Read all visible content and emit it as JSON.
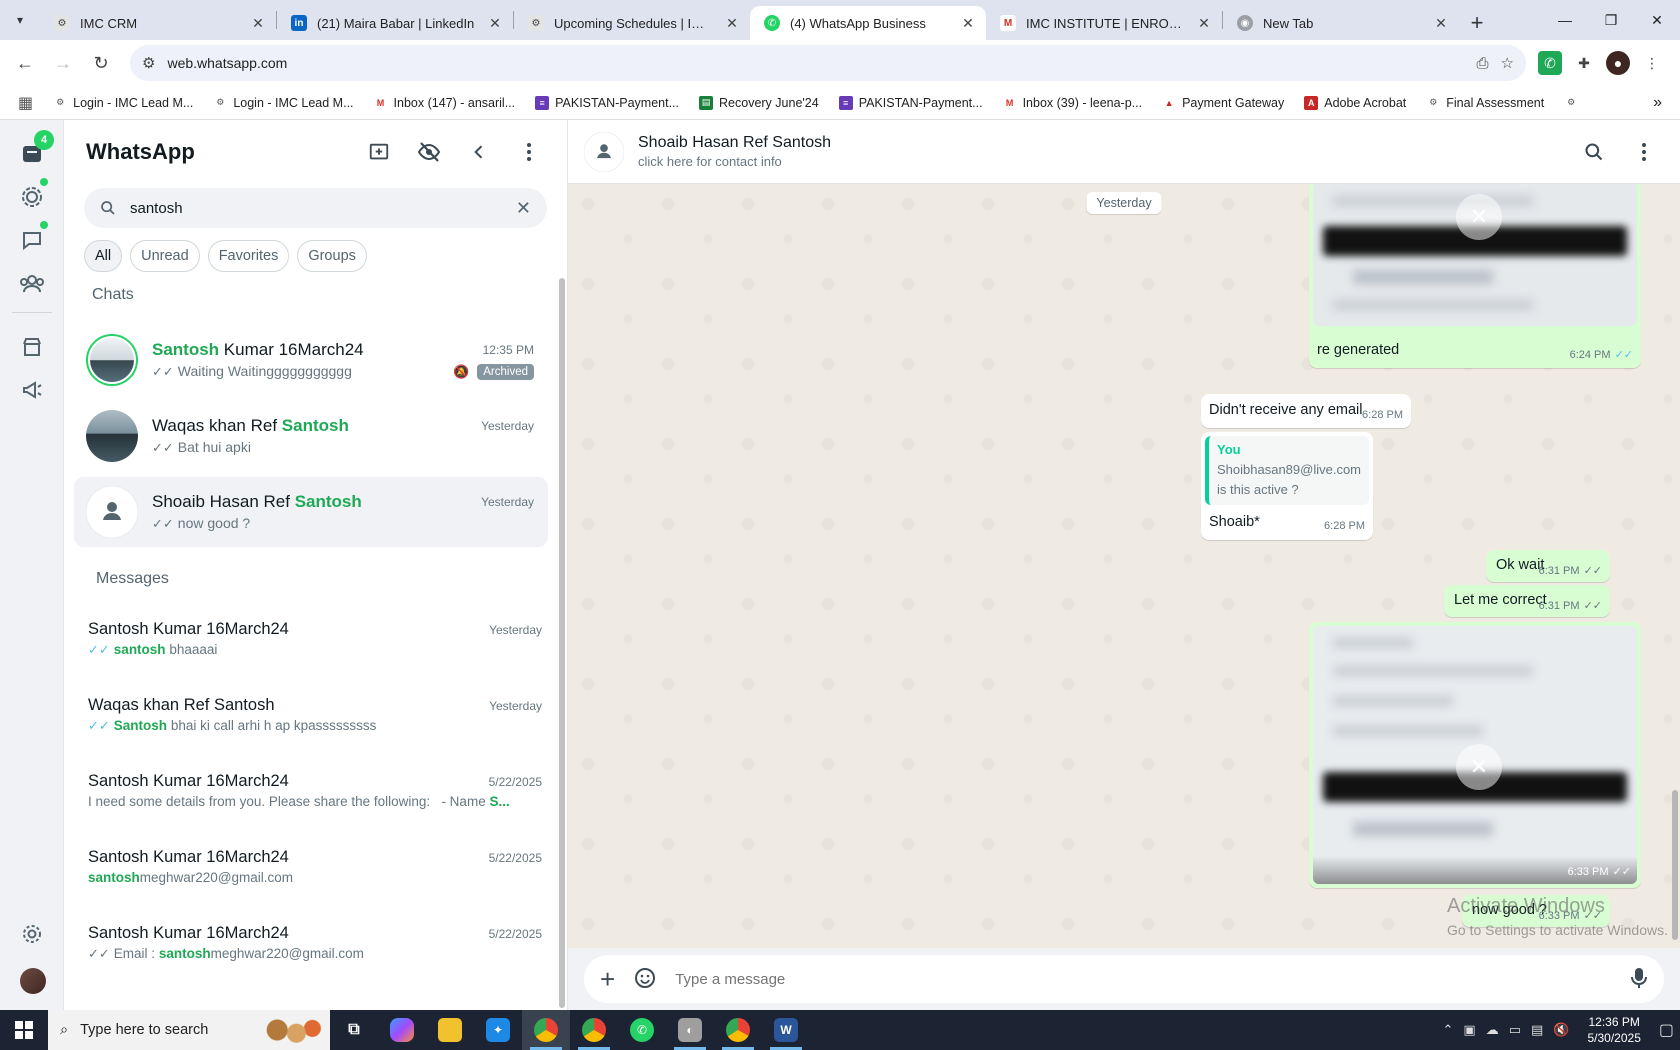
{
  "browser": {
    "tabs": [
      {
        "title": "IMC CRM",
        "active": false
      },
      {
        "title": "(21) Maira Babar | LinkedIn",
        "active": false
      },
      {
        "title": "Upcoming Schedules | IMC Cer",
        "active": false
      },
      {
        "title": "(4) WhatsApp Business",
        "active": true
      },
      {
        "title": "IMC INSTITUTE | ENROLLMENT",
        "active": false
      },
      {
        "title": "New Tab",
        "active": false
      }
    ],
    "url": "web.whatsapp.com",
    "bookmarks": [
      "Login - IMC Lead M...",
      "Login - IMC Lead M...",
      "Inbox (147) - ansaril...",
      "PAKISTAN-Payment...",
      "Recovery June'24",
      "PAKISTAN-Payment...",
      "Inbox (39) - leena-p...",
      "Payment Gateway",
      "Adobe Acrobat",
      "Final Assessment"
    ]
  },
  "rail": {
    "chats_badge": "4"
  },
  "sidebar": {
    "title": "WhatsApp",
    "search_value": "santosh",
    "filters": [
      "All",
      "Unread",
      "Favorites",
      "Groups"
    ],
    "chats_heading": "Chats",
    "messages_heading": "Messages",
    "chats": [
      {
        "name_hl": "Santosh",
        "name_rest": " Kumar 16March24",
        "time": "12:35 PM",
        "preview": "Waiting Waitinggggggggggg",
        "archived": "Archived"
      },
      {
        "name_pre": "Waqas khan Ref ",
        "name_hl": "Santosh",
        "time": "Yesterday",
        "preview": "Bat hui apki"
      },
      {
        "name_pre": "Shoaib Hasan Ref ",
        "name_hl": "Santosh",
        "time": "Yesterday",
        "preview": "now good ?"
      }
    ],
    "messages": [
      {
        "name": "Santosh Kumar 16March24",
        "time": "Yesterday",
        "hl": "santosh",
        "rest": " bhaaaai"
      },
      {
        "name": "Waqas khan Ref Santosh",
        "time": "Yesterday",
        "hl": "Santosh",
        "rest": " bhai ki call arhi h ap kpasssssssss"
      },
      {
        "name": "Santosh Kumar 16March24",
        "time": "5/22/2025",
        "pre": "I need some details from you. Please share the following:   - Name ",
        "hl": "S..."
      },
      {
        "name": "Santosh Kumar 16March24",
        "time": "5/22/2025",
        "hl": "santosh",
        "rest": "meghwar220@gmail.com"
      },
      {
        "name": "Santosh Kumar 16March24",
        "time": "5/22/2025",
        "pre": "Email : ",
        "hl": "santosh",
        "rest": "meghwar220@gmail.com"
      }
    ]
  },
  "conversation": {
    "contact_name": "Shoaib Hasan Ref Santosh",
    "contact_sub": "click here for contact info",
    "date_chip": "Yesterday",
    "messages": {
      "m1_text": "re generated",
      "m1_time": "6:24 PM",
      "m2_text": "Didn't receive any email",
      "m2_time": "6:28 PM",
      "m3_quote_author": "You",
      "m3_quote_line1": "Shoibhasan89@live.com",
      "m3_quote_line2": "is this active ?",
      "m3_text": "Shoaib*",
      "m3_time": "6:28 PM",
      "m4_text": "Ok wait",
      "m4_time": "6:31 PM",
      "m5_text": "Let me correct",
      "m5_time": "6:31 PM",
      "m6_time": "6:33 PM",
      "m7_text": "now good ?",
      "m7_time": "6:33 PM"
    },
    "composer_placeholder": "Type a message",
    "watermark_title": "Activate Windows",
    "watermark_sub": "Go to Settings to activate Windows."
  },
  "taskbar": {
    "search_placeholder": "Type here to search",
    "time": "12:36 PM",
    "date": "5/30/2025"
  },
  "colors": {
    "accent": "#25d366",
    "highlight": "#1fa855",
    "outgoing": "#d9fdd3",
    "read_tick": "#53bdeb"
  }
}
